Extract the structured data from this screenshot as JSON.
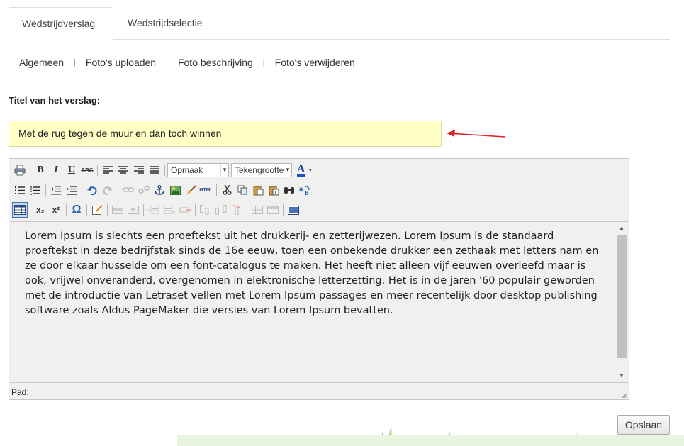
{
  "tabs": [
    {
      "label": "Wedstrijdverslag",
      "active": true
    },
    {
      "label": "Wedstrijdselectie",
      "active": false
    }
  ],
  "subnav": {
    "items": [
      "Algemeen",
      "Foto's uploaden",
      "Foto beschrijving",
      "Foto's verwijderen"
    ],
    "separator": "|"
  },
  "form": {
    "title_label": "Titel van het verslag:",
    "title_value": "Met de rug tegen de muur en dan toch winnen"
  },
  "editor": {
    "format_select": "Opmaak",
    "size_select": "Tekengrootte",
    "content": "Lorem Ipsum is slechts een proeftekst uit het drukkerij- en zetterijwezen. Lorem Ipsum is de standaard proeftekst in deze bedrijfstak sinds de 16e eeuw, toen een onbekende drukker een zethaak met letters nam en ze door elkaar husselde om een font-catalogus te maken. Het heeft niet alleen vijf eeuwen overleefd maar is ook, vrijwel onveranderd, overgenomen in elektronische letterzetting. Het is in de jaren '60 populair geworden met de introductie van Letraset vellen met Lorem Ipsum passages en meer recentelijk door desktop publishing software zoals Aldus PageMaker die versies van Lorem Ipsum bevatten.",
    "status_label": "Pad:",
    "toolbar": {
      "bold": "B",
      "italic": "I",
      "underline": "U",
      "strike": "ABC",
      "html": "HTML",
      "omega": "Ω",
      "sub": "x₂",
      "sup": "x²",
      "font_color": "A"
    }
  },
  "actions": {
    "save_label": "Opslaan"
  },
  "colors": {
    "input_bg": "#ffffc6",
    "arrow": "#e02020"
  }
}
